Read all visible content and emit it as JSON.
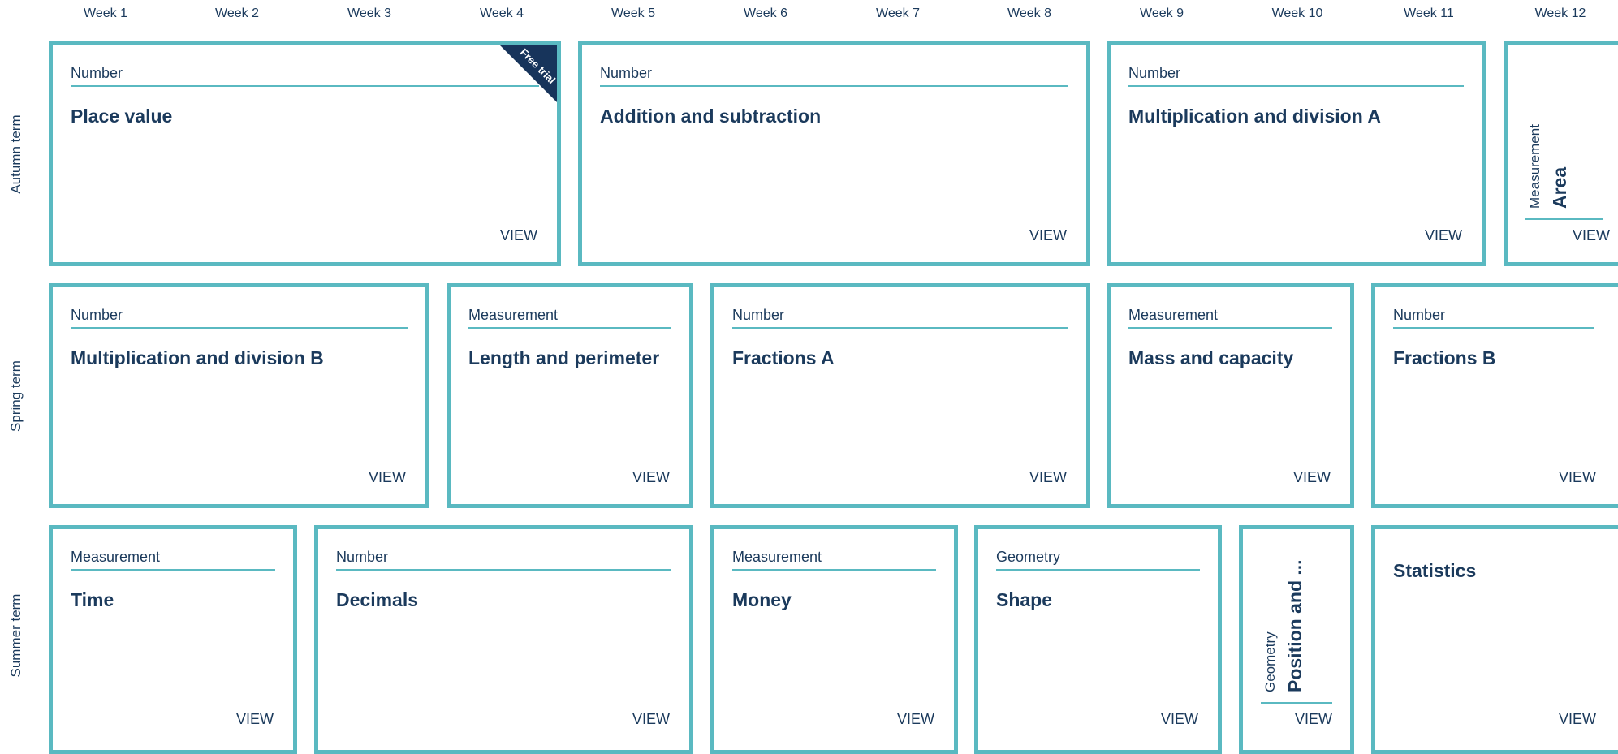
{
  "weeks": [
    "Week 1",
    "Week 2",
    "Week 3",
    "Week 4",
    "Week 5",
    "Week 6",
    "Week 7",
    "Week 8",
    "Week 9",
    "Week 10",
    "Week 11",
    "Week 12"
  ],
  "terms": [
    "Autumn term",
    "Spring term",
    "Summer term"
  ],
  "view_label": "VIEW",
  "free_trial_label": "Free trial",
  "accent_color": "#5ab9c1",
  "text_color": "#1b3a5c",
  "ribbon_color": "#17345b",
  "autumn": [
    {
      "category": "Number",
      "title": "Place value",
      "weeks": 4,
      "free_trial": true
    },
    {
      "category": "Number",
      "title": "Addition and subtraction",
      "weeks": 4
    },
    {
      "category": "Number",
      "title": "Multiplication and division A",
      "weeks": 3
    },
    {
      "category": "Measurement",
      "title": "Area",
      "weeks": 1,
      "vertical": true
    }
  ],
  "spring": [
    {
      "category": "Number",
      "title": "Multiplication and division B",
      "weeks": 3
    },
    {
      "category": "Measurement",
      "title": "Length and perimeter",
      "weeks": 2
    },
    {
      "category": "Number",
      "title": "Fractions A",
      "weeks": 3
    },
    {
      "category": "Measurement",
      "title": "Mass and capacity",
      "weeks": 2
    },
    {
      "category": "Number",
      "title": "Fractions B",
      "weeks": 2
    }
  ],
  "summer": [
    {
      "category": "Measurement",
      "title": "Time",
      "weeks": 2
    },
    {
      "category": "Number",
      "title": "Decimals",
      "weeks": 3
    },
    {
      "category": "Measurement",
      "title": "Money",
      "weeks": 2
    },
    {
      "category": "Geometry",
      "title": "Shape",
      "weeks": 2
    },
    {
      "category": "Geometry",
      "title": "Position and ...",
      "weeks": 1,
      "vertical": true
    },
    {
      "category": "",
      "title": "Statistics",
      "weeks": 2
    }
  ]
}
